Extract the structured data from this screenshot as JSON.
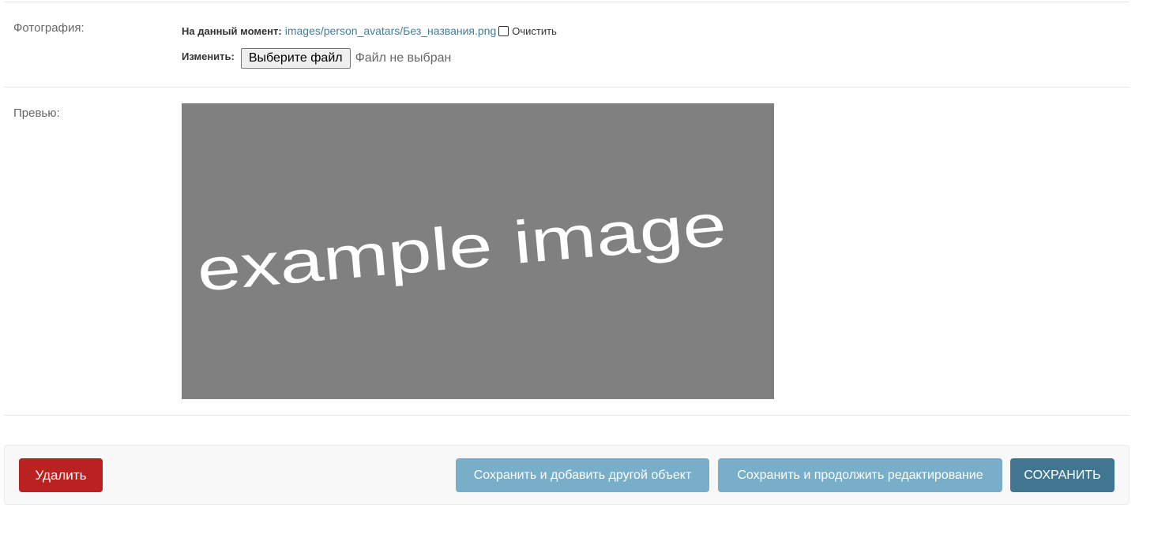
{
  "photo_field": {
    "label": "Фотография:",
    "current_label": "На данный момент:",
    "current_file": "images/person_avatars/Без_названия.png",
    "clear_label": "Очистить",
    "change_label": "Изменить:",
    "choose_button": "Выберите файл",
    "no_file_text": "Файл не выбран"
  },
  "preview_field": {
    "label": "Превью:",
    "image_text": "example image"
  },
  "actions": {
    "delete": "Удалить",
    "save_add_another": "Сохранить и добавить другой объект",
    "save_continue": "Сохранить и продолжить редактирование",
    "save": "СОХРАНИТЬ"
  },
  "colors": {
    "delete_bg": "#ba2121",
    "secondary_bg": "#79aec8",
    "primary_bg": "#417690",
    "link": "#447e9b",
    "preview_bg": "#808080"
  }
}
